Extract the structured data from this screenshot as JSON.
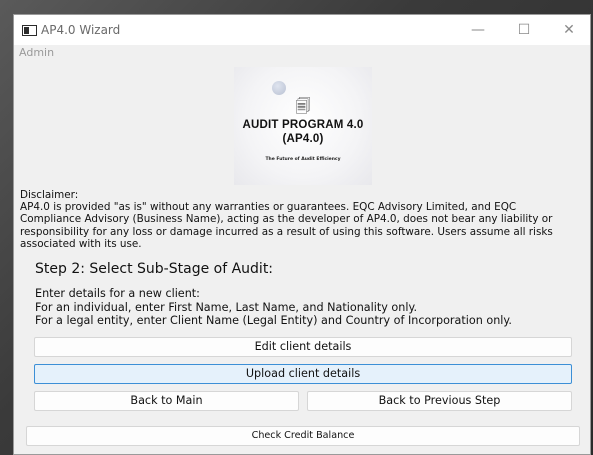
{
  "window": {
    "title": "AP4.0 Wizard",
    "minimize_glyph": "—",
    "maximize_glyph": "☐",
    "close_glyph": "✕"
  },
  "menu": {
    "items": [
      "Admin"
    ]
  },
  "logo": {
    "title_line1": "AUDIT PROGRAM 4.0",
    "title_line2": "(AP4.0)",
    "tagline": "The Future of Audit Efficiency",
    "icon": "document-chip-icon"
  },
  "disclaimer": {
    "heading": "Disclaimer:",
    "body": "AP4.0 is provided \"as is\" without any warranties or guarantees. EQC Advisory Limited, and EQC Compliance Advisory (Business Name), acting as the developer of AP4.0, does not bear any liability or responsibility for any loss or damage incurred as a result of using this software. Users assume all risks associated with its use."
  },
  "step": {
    "title": "Step 2: Select Sub-Stage of Audit:",
    "instructions": [
      "Enter details for a new client:",
      "For an individual, enter First Name, Last Name, and Nationality only.",
      "For a legal entity, enter Client Name (Legal Entity) and Country of Incorporation only."
    ]
  },
  "buttons": {
    "edit_client": "Edit client details",
    "upload_client": "Upload client details",
    "back_main": "Back to Main",
    "back_previous": "Back to Previous Step",
    "check_credit": "Check Credit Balance"
  },
  "colors": {
    "active_button_border": "#3c8fd6",
    "active_button_fill": "#e5f1fb"
  }
}
